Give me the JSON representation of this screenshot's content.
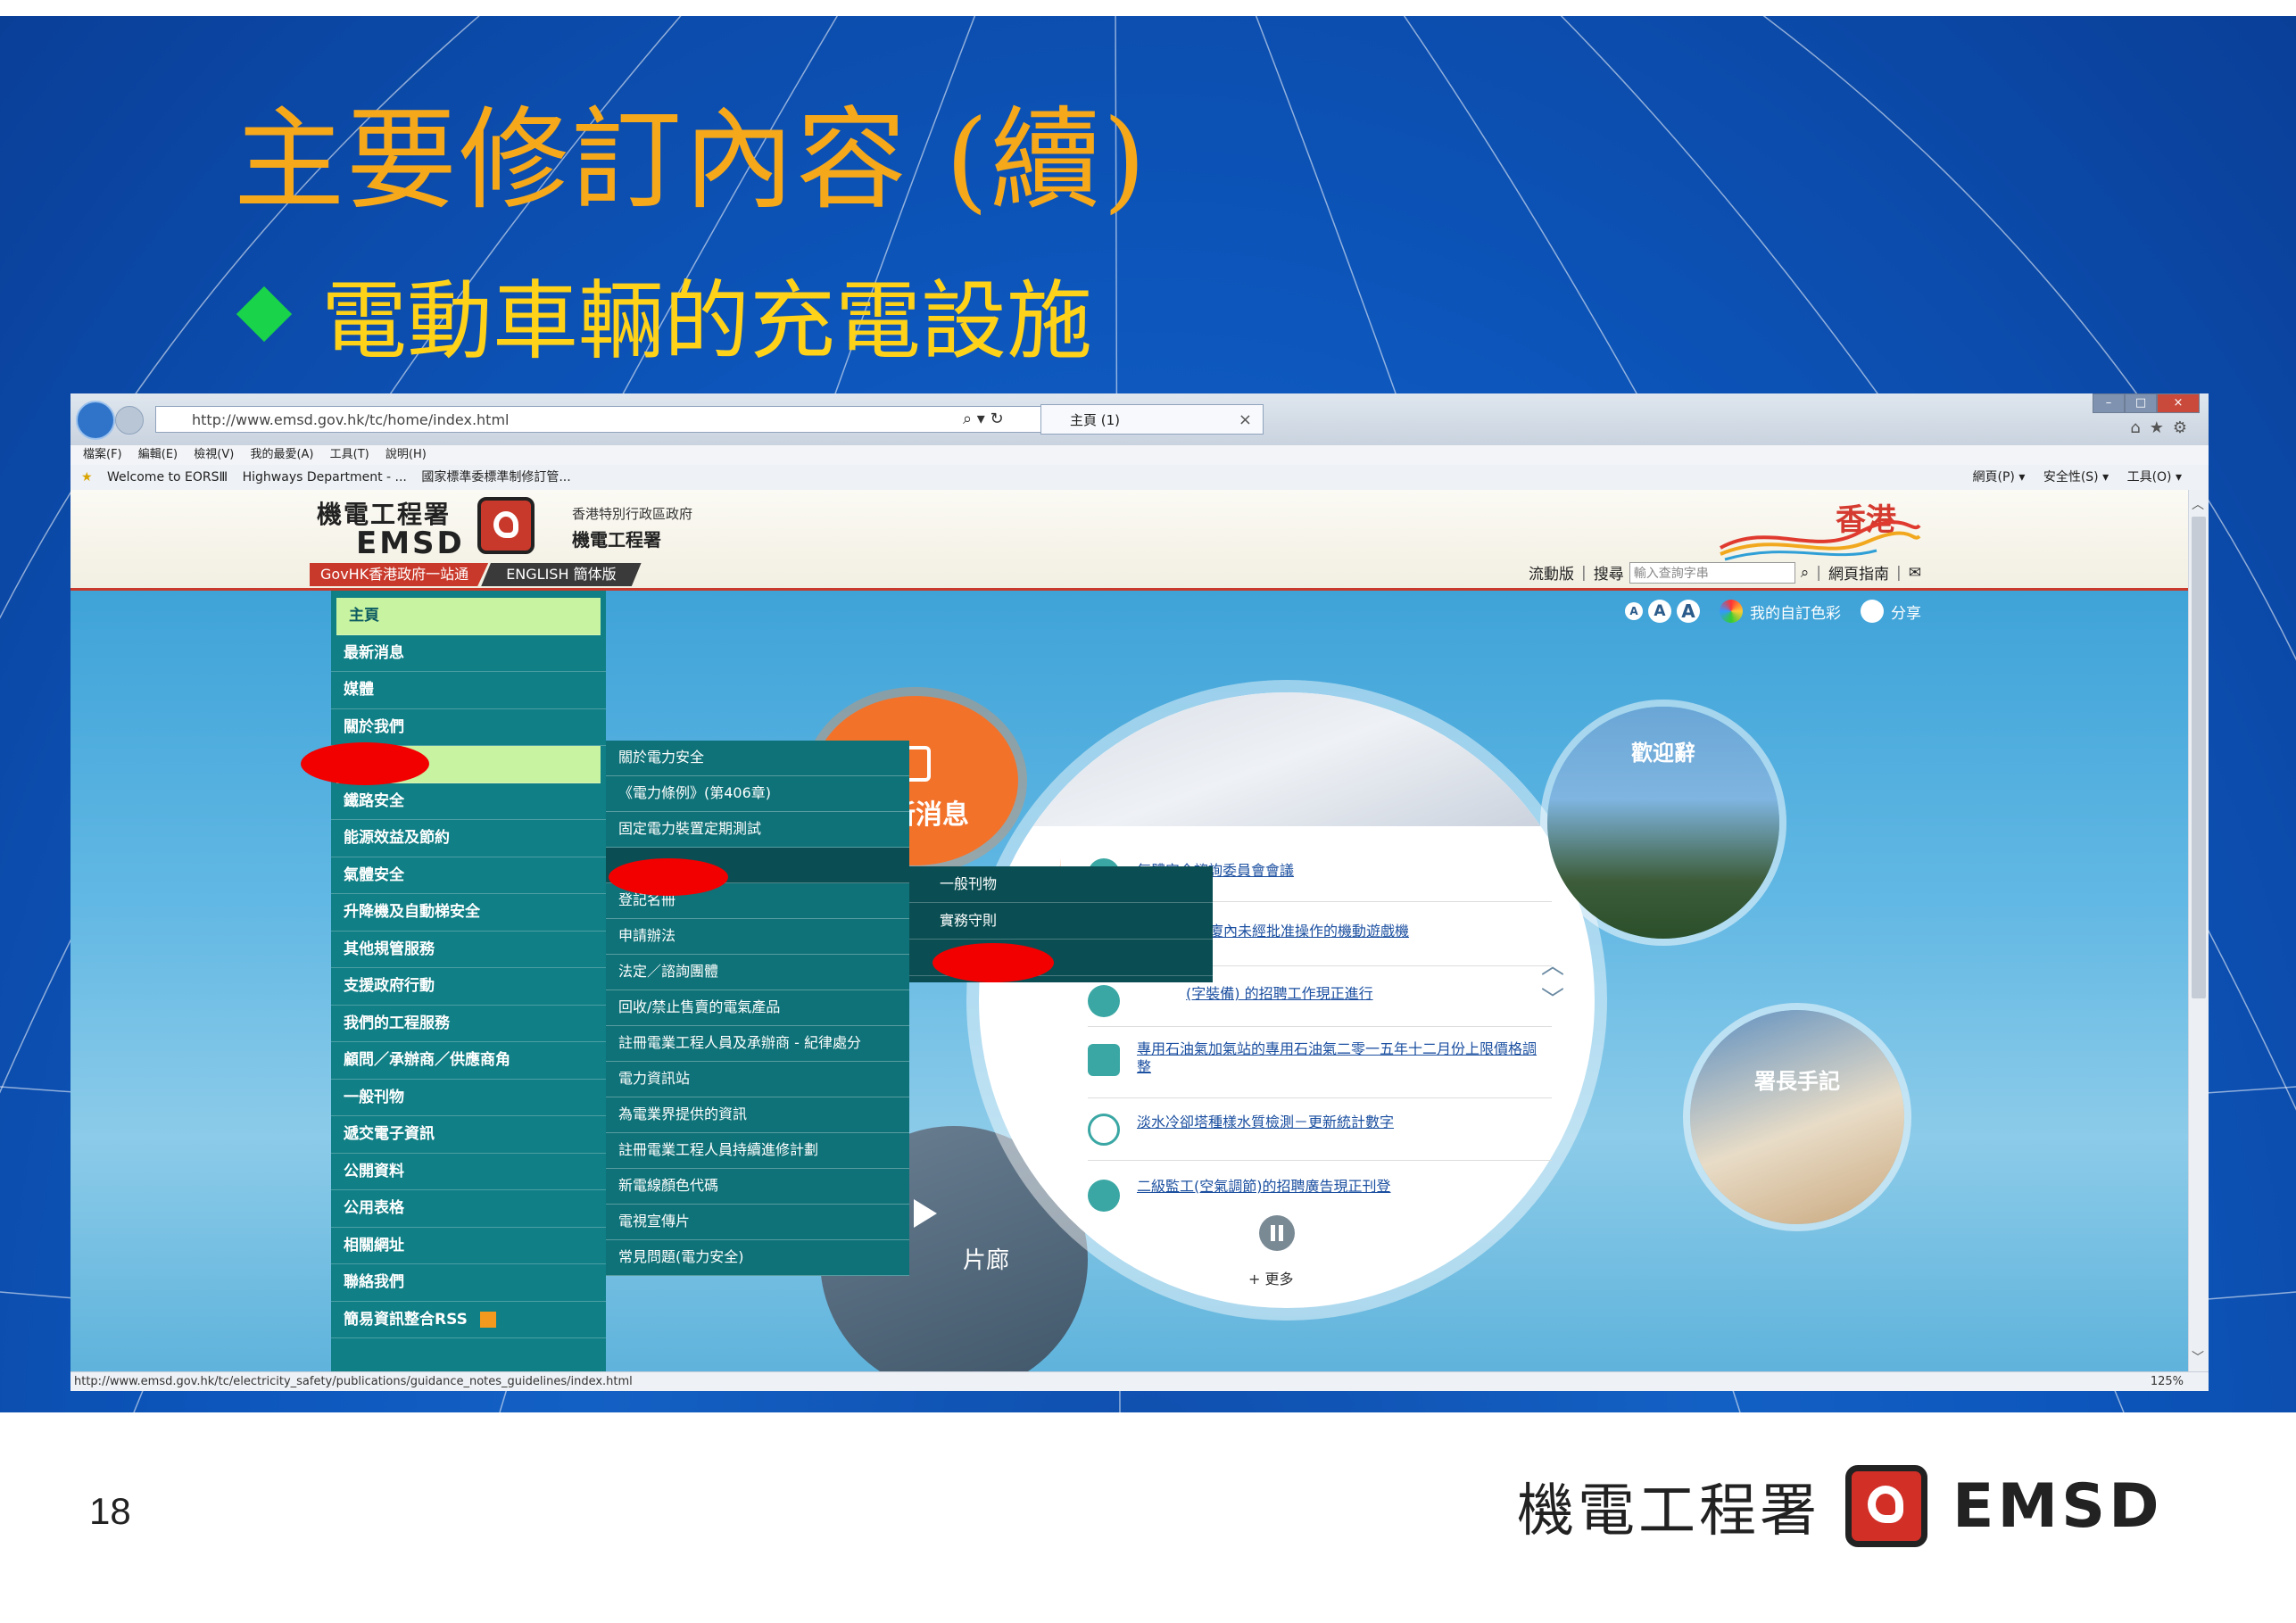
{
  "slide": {
    "title": "主要修訂內容 (續)",
    "bullet": "電動車輛的充電設施",
    "page_number": "18",
    "footer_logo_cn": "機電工程署",
    "footer_logo_en": "EMSD"
  },
  "browser": {
    "url": "http://www.emsd.gov.hk/tc/home/index.html",
    "address_controls": "⌕ ▾ ↻",
    "tab_title": "主頁 (1)",
    "menu": [
      "檔案(F)",
      "編輯(E)",
      "檢視(V)",
      "我的最愛(A)",
      "工具(T)",
      "說明(H)"
    ],
    "favorites": [
      "Welcome to EORSⅢ",
      "Highways Department - ...",
      "國家標準委標準制修訂管..."
    ],
    "command_bar": [
      "網頁(P) ▾",
      "安全性(S) ▾",
      "工具(O) ▾"
    ],
    "status_url": "http://www.emsd.gov.hk/tc/electricity_safety/publications/guidance_notes_guidelines/index.html",
    "zoom": "125%"
  },
  "site": {
    "logo_cn": "機電工程署",
    "logo_en": "EMSD",
    "gov_line1": "香港特別行政區政府",
    "gov_line2": "機電工程署",
    "govhk": "GovHK香港政府一站通",
    "lang_links": "ENGLISH  簡体版",
    "brand_hk": "香港",
    "mobile": "流動版",
    "search_label": "搜尋",
    "search_placeholder": "輸入查詢字串",
    "sitemap": "網頁指南",
    "font_sizes": [
      "A",
      "A",
      "A"
    ],
    "my_colour": "我的自訂色彩",
    "share": "分享",
    "sidebar": [
      "主頁",
      "最新消息",
      "媒體",
      "關於我們",
      "",
      "鐵路安全",
      "能源效益及節約",
      "氣體安全",
      "升降機及自動梯安全",
      "其他規管服務",
      "支援政府行動",
      "我們的工程服務",
      "顧問／承辦商／供應商角",
      "一般刊物",
      "遞交電子資訊",
      "公開資料",
      "公用表格",
      "相關網址",
      "聯絡我們",
      "簡易資訊整合RSS"
    ],
    "submenu": [
      "關於電力安全",
      "《電力條例》(第406章)",
      "固定電力裝置定期測試",
      "",
      "登記名冊",
      "申請辦法",
      "法定／諮詢團體",
      "回收/禁止售賣的電氣產品",
      "註冊電業工程人員及承辦商 - 紀律處分",
      "電力資訊站",
      "為電業界提供的資訊",
      "註冊電業工程人員持續進修計劃",
      "新電線顏色代碼",
      "電視宣傳片",
      "常見問題(電力安全)"
    ],
    "submenu2": [
      "一般刊物",
      "實務守則",
      ""
    ],
    "news_badge": "最新消息",
    "news": [
      "氣體安全諮詢委員會會議",
      "大廈內未經批准操作的機動遊戲機",
      "(字裝備) 的招聘工作現正進行",
      "專用石油氣加氣站的專用石油氣二零一五年十二月份上限價格調整",
      "淡水冷卻塔種樣水質檢測－更新統計數字",
      "二級監工(空氣調節)的招聘廣告現正刊登"
    ],
    "more": "+ 更多",
    "welcome": "歡迎辭",
    "dg_notes": "署長手記",
    "gallery": "片廊"
  },
  "colors": {
    "title": "#f6a81b",
    "bullet_text": "#ffd21a",
    "bullet_marker": "#19d34a",
    "teal": "#107f86",
    "redaction": "#f20000",
    "accent": "#c9392b"
  }
}
